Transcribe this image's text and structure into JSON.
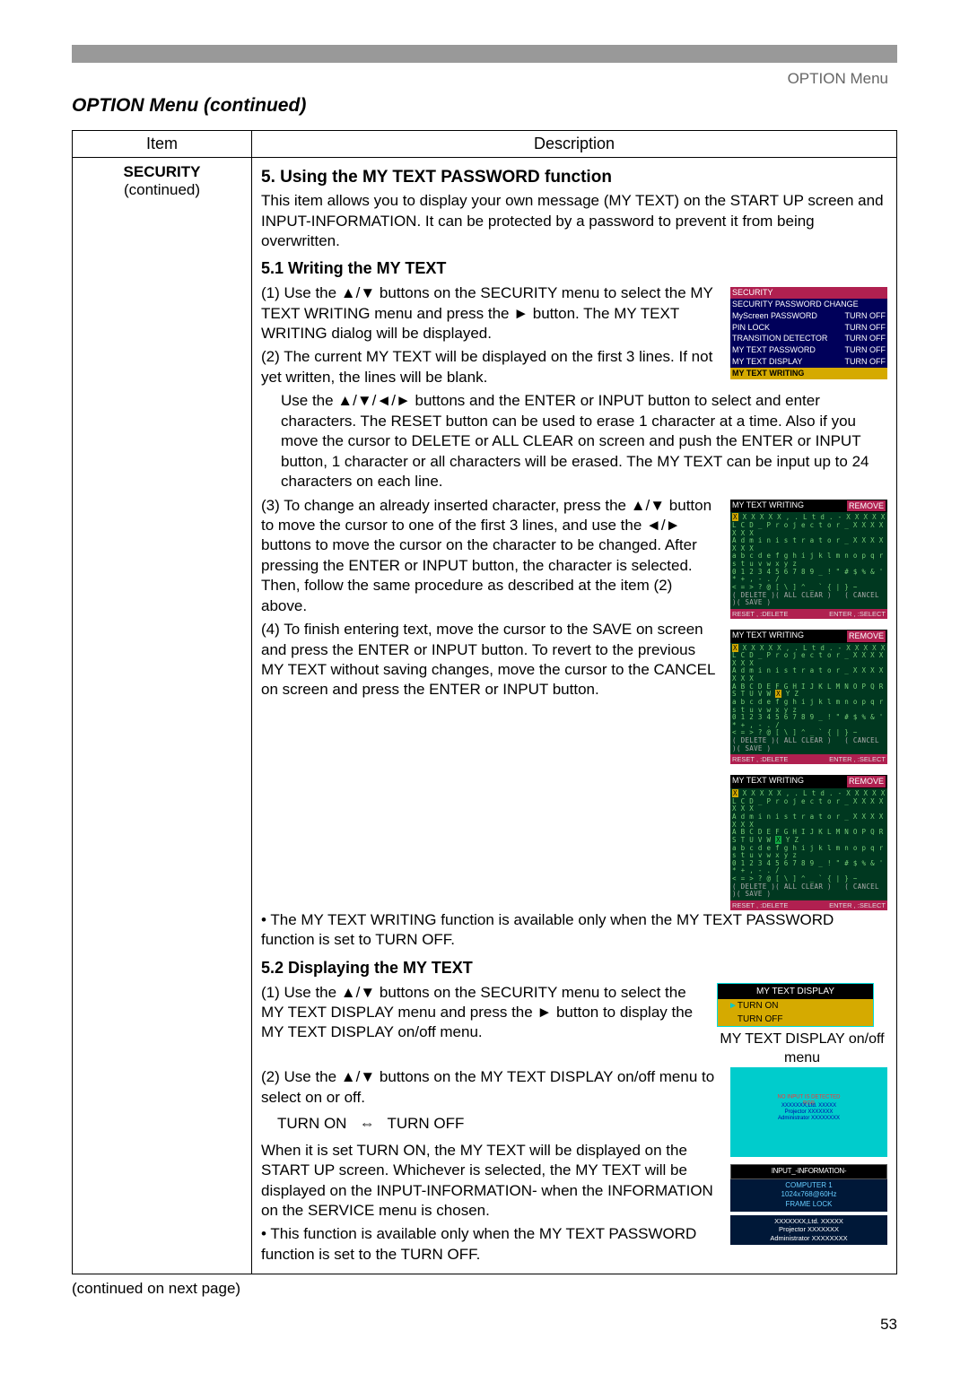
{
  "header_menu": "OPTION Menu",
  "section_title": "OPTION Menu (continued)",
  "table": {
    "col1": "Item",
    "col2": "Description"
  },
  "item": {
    "name": "SECURITY",
    "note": "(continued)"
  },
  "h5": "5. Using the MY TEXT PASSWORD function",
  "intro": "This item allows you to display your own message (MY TEXT) on the START UP screen and INPUT-INFORMATION. It can be protected by a password to prevent it from being overwritten.",
  "sec51_h": "5.1 Writing the MY TEXT",
  "p51_1": "(1) Use the ▲/▼ buttons on the SECURITY menu to select the MY TEXT WRITING menu and press the ► button. The MY TEXT WRITING dialog will be displayed.",
  "p51_2": "(2) The current MY TEXT will be displayed on the first 3 lines. If not yet written, the lines will be blank. Use the ▲/▼/◄/► buttons and the ENTER or INPUT button to select and enter characters. The RESET button can be used to erase 1 character at a time. Also if you move the cursor to DELETE or ALL CLEAR on screen and push the ENTER or INPUT button, 1 character or all characters will be erased. The MY TEXT can be input up to 24 characters on each line.",
  "p51_3": "(3) To change an already inserted character, press the ▲/▼ button to move the cursor to one of the first 3 lines, and use the ◄/► buttons to move the cursor on the character to be changed. After pressing the ENTER or INPUT button, the character is selected. Then, follow the same procedure as described at the item (2) above.",
  "p51_4": "(4) To finish entering text, move the cursor to the SAVE on screen and press the ENTER or INPUT button. To revert to the previous MY TEXT without saving changes, move the cursor to the CANCEL on screen and press the ENTER or INPUT button.",
  "p51_note": "• The MY TEXT WRITING function is available only when the MY TEXT PASSWORD function is set to TURN OFF.",
  "sec52_h": "5.2 Displaying the MY TEXT",
  "p52_1": "(1) Use the ▲/▼ buttons on the SECURITY menu to select the MY TEXT DISPLAY menu and press the ► button to display the MY TEXT DISPLAY on/off menu.",
  "p52_2": "(2) Use the ▲/▼ buttons on the MY TEXT DISPLAY on/off menu to select on or off.",
  "toggle_label": "TURN ON   ⇔   TURN OFF",
  "p52_3": "When it is set TURN ON, the MY TEXT will be displayed on the START UP screen. Whichever is selected, the MY TEXT will be displayed on the INPUT-INFORMATION- when the INFORMATION on the SERVICE menu is chosen.",
  "p52_note": "• This function is available only when the MY TEXT PASSWORD function is set to the TURN OFF.",
  "sec_menu": {
    "title": "SECURITY",
    "r1": "SECURITY PASSWORD CHANGE",
    "r2a": "MyScreen PASSWORD",
    "r2b": "TURN OFF",
    "r3a": "PIN LOCK",
    "r3b": "TURN OFF",
    "r4a": "TRANSITION DETECTOR",
    "r4b": "TURN OFF",
    "r5a": "MY TEXT PASSWORD",
    "r5b": "TURN OFF",
    "r6a": "MY TEXT DISPLAY",
    "r6b": "TURN OFF",
    "r7": "MY TEXT WRITING"
  },
  "write": {
    "title": "MY TEXT WRITING",
    "remove": "REMOVE",
    "l1": "X X X X X X , . L t d . - X X X X X",
    "l2": "L C D _ P r o j e c t o r _ X X X X X X X",
    "l3": "A d m i n i s t r a t o r _ X X X X X X X",
    "g1": "A B C D E F G H I J K L M N O P Q R S T U V W X Y Z",
    "g2": "a b c d e f g h i j k l m n o p q r s t u v w x y z",
    "g3": "0 1 2 3 4 5 6 7 8 9 _ ! \" # $ % & ' * + , - . /",
    "g4": "< = > ? @ [ \\ ] ^ _ ` { | } ~",
    "bDelete": "DELETE",
    "bAllClear": "ALL CLEAR",
    "bCancel": "CANCEL",
    "bSave": "SAVE",
    "reset": "RESET , :DELETE",
    "enter": "ENTER , :SELECT"
  },
  "display_menu": {
    "title": "MY TEXT DISPLAY",
    "on": "TURN ON",
    "off": "TURN OFF"
  },
  "display_caption": "MY TEXT DISPLAY on/off menu",
  "cyan": {
    "t1": "NO INPUT IS DETECTED",
    "t2": "RGB",
    "t3": "XXXXXXX,Ltd. XXXXX",
    "t4": "Projector XXXXXXX",
    "t5": "Administrator XXXXXXXX"
  },
  "info": {
    "title": "INPUT_-INFORMATION-",
    "b1": "COMPUTER 1",
    "b2": "1024x768@60Hz",
    "b3": "FRAME LOCK",
    "b4": "XXXXXXX,Ltd. XXXXX",
    "b5": "Projector XXXXXXX",
    "b6": "Administrator XXXXXXXX"
  },
  "continued": "(continued on next page)",
  "pageno": "53"
}
